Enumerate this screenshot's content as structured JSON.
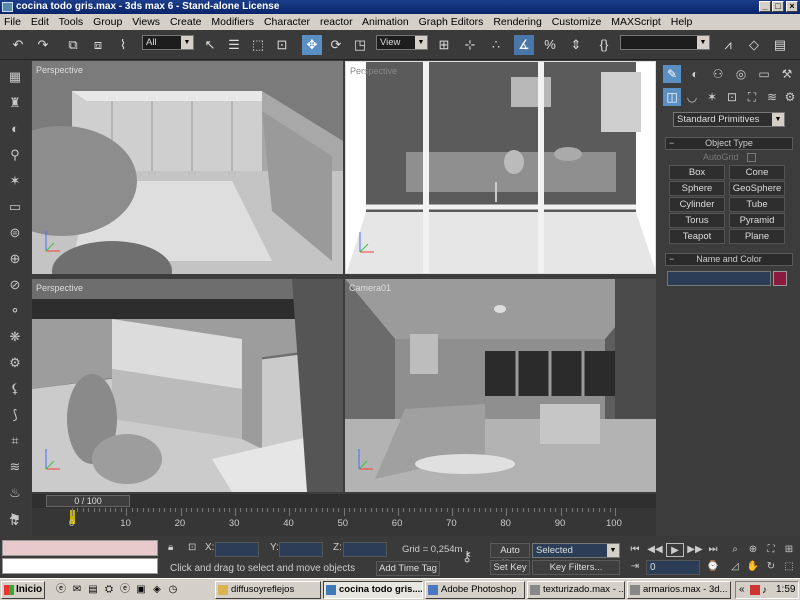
{
  "window": {
    "title": "cocina todo gris.max - 3ds max 6 - Stand-alone License",
    "controls": [
      "_",
      "□",
      "×"
    ]
  },
  "menu": [
    "File",
    "Edit",
    "Tools",
    "Group",
    "Views",
    "Create",
    "Modifiers",
    "Character",
    "reactor",
    "Animation",
    "Graph Editors",
    "Rendering",
    "Customize",
    "MAXScript",
    "Help"
  ],
  "toolbar": {
    "selection_filter": "All",
    "reference_coord": "View",
    "named_selection": ""
  },
  "viewports": {
    "top_left": "Perspective",
    "top_right": "Perspective",
    "bottom_left": "Perspective",
    "bottom_right": "Camera01"
  },
  "command_panel": {
    "category": "Standard Primitives",
    "object_type_header": "Object Type",
    "autogrid": "AutoGrid",
    "buttons": [
      "Box",
      "Cone",
      "Sphere",
      "GeoSphere",
      "Cylinder",
      "Tube",
      "Torus",
      "Pyramid",
      "Teapot",
      "Plane"
    ],
    "name_color_header": "Name and Color",
    "name_value": "",
    "color": "#8b1a3c"
  },
  "time": {
    "frame_display": "0 / 100",
    "ticks": [
      "0",
      "10",
      "20",
      "30",
      "40",
      "50",
      "60",
      "70",
      "80",
      "90",
      "100"
    ]
  },
  "status": {
    "prompt": "Click and drag to select and move objects",
    "x_label": "X:",
    "y_label": "Y:",
    "z_label": "Z:",
    "grid": "Grid = 0,254m",
    "add_time_tag": "Add Time Tag",
    "auto_key": "Auto Key",
    "set_key": "Set Key",
    "key_mode": "Selected",
    "key_filters": "Key Filters...",
    "current_frame": "0"
  },
  "taskbar": {
    "start": "Inicio",
    "tasks": [
      {
        "label": "diffusoyreflejos",
        "active": false
      },
      {
        "label": "cocina todo gris....",
        "active": true
      },
      {
        "label": "Adobe Photoshop",
        "active": false
      },
      {
        "label": "texturizado.max - ...",
        "active": false
      },
      {
        "label": "armarios.max - 3d...",
        "active": false
      }
    ],
    "tray_arrows": "«",
    "clock": "1:59"
  },
  "colors": {
    "accent_blue": "#5a8fc4",
    "title_blue": "#0a246a",
    "field_blue": "#2c3e57",
    "panel_grey": "#3c3c3c"
  }
}
